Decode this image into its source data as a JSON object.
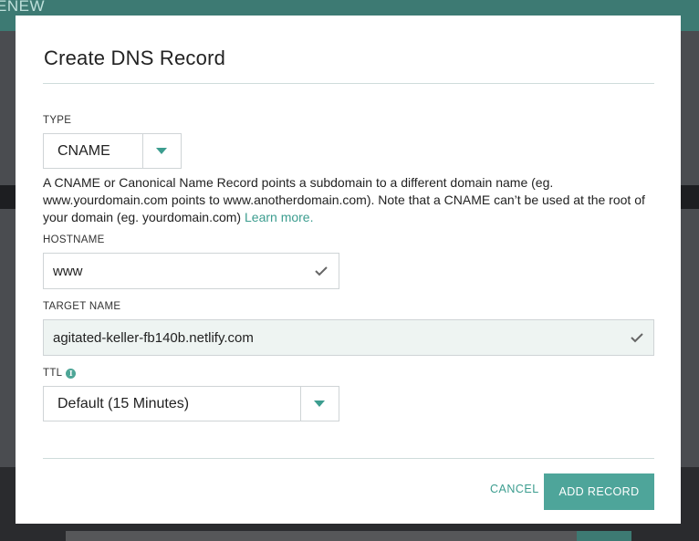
{
  "background": {
    "topbar_text": "ENEW"
  },
  "modal": {
    "title": "Create DNS Record"
  },
  "type_field": {
    "label": "TYPE",
    "selected": "CNAME",
    "description": "A CNAME or Canonical Name Record points a subdomain to a different domain name (eg. www.yourdomain.com points to www.anotherdomain.com). Note that a CNAME can’t be used at the root of your domain (eg. yourdomain.com)",
    "learn_more": "Learn more."
  },
  "hostname_field": {
    "label": "HOSTNAME",
    "value": "www",
    "valid": true
  },
  "target_field": {
    "label": "TARGET NAME",
    "value": "agitated-keller-fb140b.netlify.com",
    "valid": true
  },
  "ttl_field": {
    "label": "TTL",
    "info_icon": "info-icon",
    "selected": "Default (15 Minutes)"
  },
  "actions": {
    "cancel": "CANCEL",
    "add": "ADD RECORD"
  },
  "colors": {
    "accent": "#3c9d8f",
    "button_bg": "#4ea59a",
    "overlay": "#4a4c50"
  }
}
